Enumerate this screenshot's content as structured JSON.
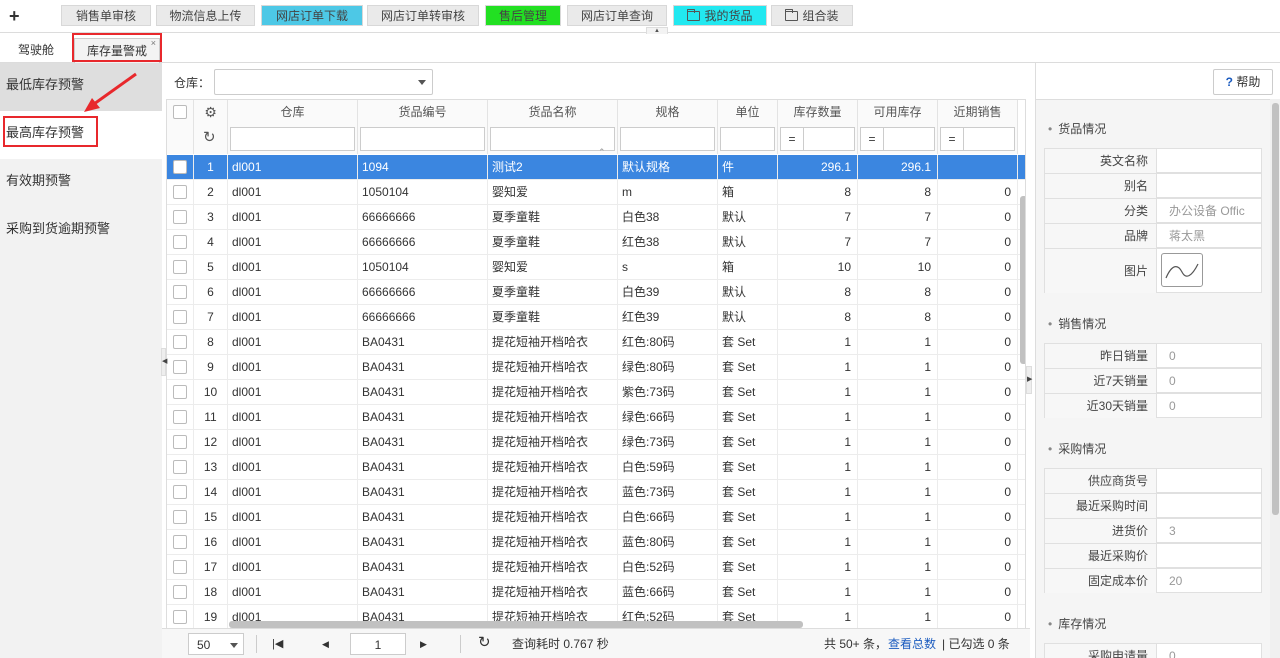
{
  "toolbar": {
    "add_label": "+",
    "buttons": [
      {
        "label": "销售单审核",
        "bg": "#eaeaea",
        "folder": false
      },
      {
        "label": "物流信息上传",
        "bg": "#eaeaea",
        "folder": false
      },
      {
        "label": "网店订单下载",
        "bg": "#4dc8e6",
        "folder": false
      },
      {
        "label": "网店订单转审核",
        "bg": "#eaeaea",
        "folder": false
      },
      {
        "label": "售后管理",
        "bg": "#22e022",
        "folder": false
      },
      {
        "label": "网店订单查询",
        "bg": "#eaeaea",
        "folder": false
      },
      {
        "label": "我的货品",
        "bg": "#22e8f0",
        "folder": true
      },
      {
        "label": "组合装",
        "bg": "#eaeaea",
        "folder": true
      }
    ]
  },
  "tabs": {
    "cockpit": "驾驶舱",
    "stock_alert": "库存量警戒",
    "close": "×"
  },
  "sidebar": {
    "items": [
      {
        "label": "最低库存预警",
        "state": "gray"
      },
      {
        "label": "最高库存预警",
        "state": "active"
      },
      {
        "label": "有效期预警",
        "state": "normal"
      },
      {
        "label": "采购到货逾期预警",
        "state": "normal"
      }
    ]
  },
  "filter": {
    "warehouse_label": "仓库：",
    "warehouse_value": ""
  },
  "grid": {
    "columns": [
      "仓库",
      "货品编号",
      "货品名称",
      "规格",
      "单位",
      "库存数量",
      "可用库存",
      "近期销售"
    ],
    "eq": "=",
    "rows": [
      [
        "1",
        "dl001",
        "1094",
        "测试2",
        "默认规格",
        "件",
        "296.1",
        "296.1",
        ""
      ],
      [
        "2",
        "dl001",
        "1050104",
        "婴知爱",
        "m",
        "箱",
        "8",
        "8",
        "0"
      ],
      [
        "3",
        "dl001",
        "66666666",
        "夏季童鞋",
        "白色38",
        "默认",
        "7",
        "7",
        "0"
      ],
      [
        "4",
        "dl001",
        "66666666",
        "夏季童鞋",
        "红色38",
        "默认",
        "7",
        "7",
        "0"
      ],
      [
        "5",
        "dl001",
        "1050104",
        "婴知爱",
        "s",
        "箱",
        "10",
        "10",
        "0"
      ],
      [
        "6",
        "dl001",
        "66666666",
        "夏季童鞋",
        "白色39",
        "默认",
        "8",
        "8",
        "0"
      ],
      [
        "7",
        "dl001",
        "66666666",
        "夏季童鞋",
        "红色39",
        "默认",
        "8",
        "8",
        "0"
      ],
      [
        "8",
        "dl001",
        "BA0431",
        "提花短袖开档哈衣",
        "红色:80码",
        "套 Set",
        "1",
        "1",
        "0"
      ],
      [
        "9",
        "dl001",
        "BA0431",
        "提花短袖开档哈衣",
        "绿色:80码",
        "套 Set",
        "1",
        "1",
        "0"
      ],
      [
        "10",
        "dl001",
        "BA0431",
        "提花短袖开档哈衣",
        "紫色:73码",
        "套 Set",
        "1",
        "1",
        "0"
      ],
      [
        "11",
        "dl001",
        "BA0431",
        "提花短袖开档哈衣",
        "绿色:66码",
        "套 Set",
        "1",
        "1",
        "0"
      ],
      [
        "12",
        "dl001",
        "BA0431",
        "提花短袖开档哈衣",
        "绿色:73码",
        "套 Set",
        "1",
        "1",
        "0"
      ],
      [
        "13",
        "dl001",
        "BA0431",
        "提花短袖开档哈衣",
        "白色:59码",
        "套 Set",
        "1",
        "1",
        "0"
      ],
      [
        "14",
        "dl001",
        "BA0431",
        "提花短袖开档哈衣",
        "蓝色:73码",
        "套 Set",
        "1",
        "1",
        "0"
      ],
      [
        "15",
        "dl001",
        "BA0431",
        "提花短袖开档哈衣",
        "白色:66码",
        "套 Set",
        "1",
        "1",
        "0"
      ],
      [
        "16",
        "dl001",
        "BA0431",
        "提花短袖开档哈衣",
        "蓝色:80码",
        "套 Set",
        "1",
        "1",
        "0"
      ],
      [
        "17",
        "dl001",
        "BA0431",
        "提花短袖开档哈衣",
        "白色:52码",
        "套 Set",
        "1",
        "1",
        "0"
      ],
      [
        "18",
        "dl001",
        "BA0431",
        "提花短袖开档哈衣",
        "蓝色:66码",
        "套 Set",
        "1",
        "1",
        "0"
      ],
      [
        "19",
        "dl001",
        "BA0431",
        "提花短袖开档哈衣",
        "红色:52码",
        "套 Set",
        "1",
        "1",
        "0"
      ]
    ]
  },
  "pager": {
    "page_size": "50",
    "page": "1",
    "query_time": "查询耗时 0.767 秒",
    "total": "共 50+ 条，",
    "view_total": "查看总数",
    "checked": "| 已勾选 0 条"
  },
  "right_panel": {
    "help": "帮助",
    "sections": [
      {
        "title": "货品情况",
        "rows": [
          [
            "英文名称",
            ""
          ],
          [
            "别名",
            ""
          ],
          [
            "分类",
            "办公设备 Offic"
          ],
          [
            "品牌",
            "蒋太黑"
          ],
          [
            "图片",
            ""
          ]
        ]
      },
      {
        "title": "销售情况",
        "rows": [
          [
            "昨日销量",
            "0"
          ],
          [
            "近7天销量",
            "0"
          ],
          [
            "近30天销量",
            "0"
          ]
        ]
      },
      {
        "title": "采购情况",
        "rows": [
          [
            "供应商货号",
            ""
          ],
          [
            "最近采购时间",
            ""
          ],
          [
            "进货价",
            "3"
          ],
          [
            "最近采购价",
            ""
          ],
          [
            "固定成本价",
            "20"
          ]
        ]
      },
      {
        "title": "库存情况",
        "rows": [
          [
            "采购申请量",
            "0"
          ]
        ]
      }
    ]
  },
  "colors": {
    "selected_row": "#3b86e0",
    "highlight": "#e8282c",
    "link": "#1a5bbf"
  }
}
